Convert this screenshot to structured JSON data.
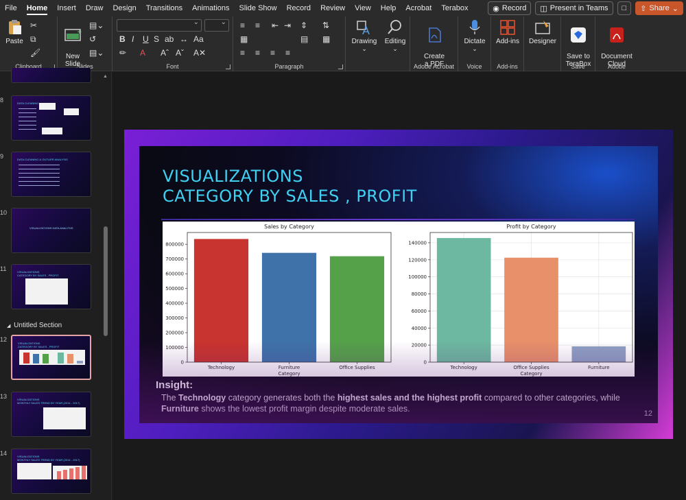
{
  "menubar": {
    "tabs": [
      "File",
      "Home",
      "Insert",
      "Draw",
      "Design",
      "Transitions",
      "Animations",
      "Slide Show",
      "Record",
      "Review",
      "View",
      "Help",
      "Acrobat",
      "Terabox"
    ],
    "active_tab": "Home",
    "record_label": "Record",
    "present_label": "Present in Teams",
    "share_label": "Share"
  },
  "ribbon": {
    "clipboard": {
      "paste_label": "Paste",
      "group_label": "Clipboard"
    },
    "slides": {
      "new_slide_label": "New\nSlide",
      "group_label": "Slides"
    },
    "font": {
      "group_label": "Font"
    },
    "paragraph": {
      "group_label": "Paragraph"
    },
    "drawing": {
      "label": "Drawing"
    },
    "editing": {
      "label": "Editing"
    },
    "adobe_acrobat": {
      "create_pdf_label": "Create\na PDF",
      "group_label": "Adobe Acrobat"
    },
    "voice": {
      "dictate_label": "Dictate",
      "group_label": "Voice"
    },
    "addins": {
      "label": "Add-ins",
      "group_label": "Add-ins"
    },
    "designer": {
      "label": "Designer"
    },
    "save": {
      "terabox_label": "Save to\nTeraBox",
      "group_label": "Save"
    },
    "adobe": {
      "doc_cloud_label": "Document\nCloud",
      "group_label": "Adobe"
    }
  },
  "thumbnails": {
    "section_label": "Untitled Section",
    "items": [
      {
        "num": "8",
        "title": "DATA CLEANING"
      },
      {
        "num": "9",
        "title": "DATA CLEANING & OUTLIER ANALYSIS"
      },
      {
        "num": "10",
        "title": "VISUALIZATIONS DATA ANALYSIS"
      },
      {
        "num": "11",
        "title": "VISUALIZATIONS\nCATEGORY BY SALES , PROFIT"
      },
      {
        "num": "12",
        "title": "VISUALIZATIONS\nCATEGORY BY SALES , PROFIT"
      },
      {
        "num": "13",
        "title": "VISUALIZATIONS\nMONTHLY SALES TREND BY YEAR (2014 - 2017)"
      },
      {
        "num": "14",
        "title": "VISUALIZATIONS\nMONTHLY SALES TREND BY YEAR (2014 - 2017)"
      }
    ]
  },
  "slide": {
    "title_line1": "VISUALIZATIONS",
    "title_line2": "CATEGORY BY SALES , PROFIT",
    "insight_title": "Insight:",
    "insight_p1": "The ",
    "insight_b1": "Technology",
    "insight_p2": " category generates both the ",
    "insight_b2": "highest sales and the highest profit",
    "insight_p3": " compared to other categories, while ",
    "insight_b3": "Furniture",
    "insight_p4": " shows the lowest profit margin despite moderate sales.",
    "slide_number": "12"
  },
  "chart_data": [
    {
      "type": "bar",
      "title": "Sales by Category",
      "xlabel": "Category",
      "ylabel": "",
      "categories": [
        "Technology",
        "Furniture",
        "Office Supplies"
      ],
      "values": [
        836000,
        742000,
        719000
      ],
      "colors": [
        "#c8342f",
        "#3e72a8",
        "#55a14a"
      ],
      "ylim": [
        0,
        880000
      ],
      "yticks": [
        0,
        100000,
        200000,
        300000,
        400000,
        500000,
        600000,
        700000,
        800000
      ],
      "grid": false
    },
    {
      "type": "bar",
      "title": "Profit by Category",
      "xlabel": "Category",
      "ylabel": "",
      "categories": [
        "Technology",
        "Office Supplies",
        "Furniture"
      ],
      "values": [
        145500,
        122500,
        18500
      ],
      "colors": [
        "#6db8a0",
        "#e8906a",
        "#8e9fc3"
      ],
      "ylim": [
        0,
        152000
      ],
      "yticks": [
        0,
        20000,
        40000,
        60000,
        80000,
        100000,
        120000,
        140000
      ],
      "grid": true
    }
  ]
}
